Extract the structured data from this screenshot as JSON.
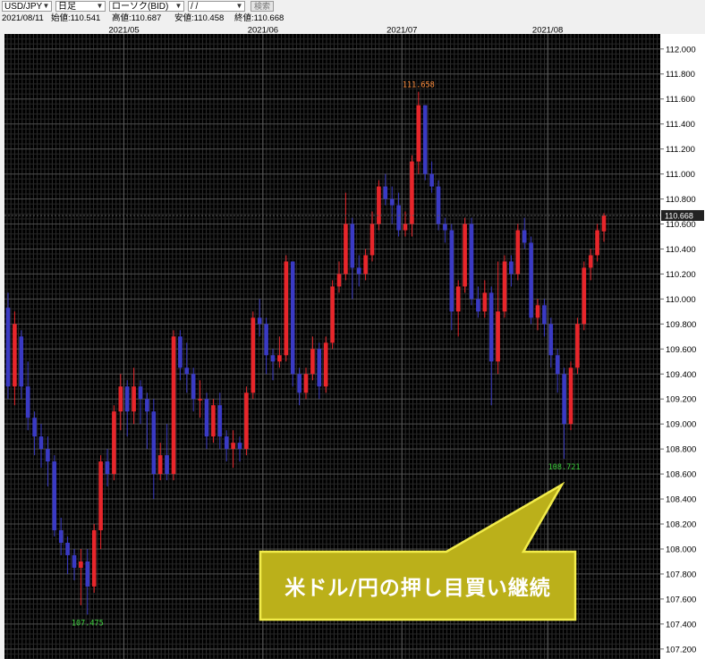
{
  "toolbar": {
    "symbol": "USD/JPY",
    "timeframe": "日足",
    "chart_style": "ローソク(BID)",
    "date": " /  / ",
    "search_label": "検索"
  },
  "ohlc": {
    "date": "2021/08/11",
    "open": "始値:110.541",
    "high": "高値:110.687",
    "low": "安値:110.458",
    "close": "終値:110.668"
  },
  "annotation": {
    "text": "米ドル/円の押し目買い継続"
  },
  "chart_data": {
    "type": "candlestick",
    "x_labels": [
      "2021/05",
      "2021/06",
      "2021/07",
      "2021/08"
    ],
    "y_ticks": [
      "112.000",
      "111.800",
      "111.600",
      "111.400",
      "111.200",
      "111.000",
      "110.800",
      "110.600",
      "110.400",
      "110.200",
      "110.000",
      "109.800",
      "109.600",
      "109.400",
      "109.200",
      "109.000",
      "108.800",
      "108.600",
      "108.400",
      "108.200",
      "108.000",
      "107.800",
      "107.600",
      "107.400",
      "107.200"
    ],
    "ylim": [
      107.12,
      112.12
    ],
    "grid": true,
    "last_price": "110.668",
    "high_label": "111.658",
    "low_labels": [
      "107.475",
      "108.721"
    ],
    "candles": [
      [
        109.93,
        109.3,
        110.05,
        109.2
      ],
      [
        109.3,
        109.8,
        109.9,
        109.15
      ],
      [
        109.7,
        109.3,
        109.75,
        109.2
      ],
      [
        109.3,
        109.05,
        109.5,
        108.95
      ],
      [
        109.05,
        108.9,
        109.1,
        108.75
      ],
      [
        108.9,
        108.8,
        109.0,
        108.65
      ],
      [
        108.8,
        108.7,
        108.9,
        108.5
      ],
      [
        108.7,
        108.15,
        108.75,
        108.1
      ],
      [
        108.15,
        108.05,
        108.25,
        107.95
      ],
      [
        108.05,
        107.95,
        108.1,
        107.8
      ],
      [
        107.95,
        107.85,
        108.0,
        107.75
      ],
      [
        107.85,
        107.9,
        108.0,
        107.55
      ],
      [
        107.9,
        107.7,
        108.0,
        107.475
      ],
      [
        107.7,
        108.15,
        108.2,
        107.65
      ],
      [
        108.15,
        108.7,
        108.75,
        108.0
      ],
      [
        108.7,
        108.6,
        108.8,
        108.5
      ],
      [
        108.6,
        109.1,
        109.15,
        108.55
      ],
      [
        109.1,
        109.3,
        109.4,
        108.95
      ],
      [
        109.3,
        109.1,
        109.35,
        108.9
      ],
      [
        109.1,
        109.3,
        109.45,
        109.0
      ],
      [
        109.3,
        109.2,
        109.35,
        109.0
      ],
      [
        109.2,
        109.1,
        109.25,
        108.8
      ],
      [
        109.1,
        108.6,
        109.2,
        108.4
      ],
      [
        108.6,
        108.75,
        108.85,
        108.55
      ],
      [
        108.75,
        108.6,
        109.0,
        108.55
      ],
      [
        108.6,
        109.7,
        109.75,
        108.55
      ],
      [
        109.7,
        109.45,
        109.75,
        109.35
      ],
      [
        109.45,
        109.4,
        109.65,
        109.25
      ],
      [
        109.4,
        109.2,
        109.45,
        109.1
      ],
      [
        109.2,
        109.2,
        109.35,
        109.05
      ],
      [
        109.2,
        108.9,
        109.25,
        108.8
      ],
      [
        108.9,
        109.15,
        109.2,
        108.85
      ],
      [
        109.15,
        108.9,
        109.25,
        108.8
      ],
      [
        108.9,
        108.8,
        108.95,
        108.7
      ],
      [
        108.8,
        108.85,
        108.95,
        108.65
      ],
      [
        108.85,
        108.8,
        108.9,
        108.7
      ],
      [
        108.8,
        109.25,
        109.3,
        108.75
      ],
      [
        109.25,
        109.85,
        109.9,
        109.2
      ],
      [
        109.85,
        109.8,
        110.0,
        109.7
      ],
      [
        109.8,
        109.55,
        109.85,
        109.4
      ],
      [
        109.55,
        109.5,
        109.6,
        109.35
      ],
      [
        109.5,
        109.55,
        109.7,
        109.45
      ],
      [
        109.55,
        110.3,
        110.35,
        109.5
      ],
      [
        110.3,
        109.4,
        110.3,
        109.3
      ],
      [
        109.4,
        109.25,
        109.45,
        109.15
      ],
      [
        109.25,
        109.4,
        109.45,
        109.2
      ],
      [
        109.4,
        109.6,
        109.7,
        109.35
      ],
      [
        109.6,
        109.3,
        109.65,
        109.2
      ],
      [
        109.3,
        109.65,
        109.7,
        109.25
      ],
      [
        109.65,
        110.1,
        110.15,
        109.6
      ],
      [
        110.1,
        110.2,
        110.3,
        110.05
      ],
      [
        110.2,
        110.6,
        110.85,
        110.15
      ],
      [
        110.6,
        110.25,
        110.65,
        110.0
      ],
      [
        110.25,
        110.2,
        110.35,
        110.1
      ],
      [
        110.2,
        110.35,
        110.4,
        110.15
      ],
      [
        110.35,
        110.6,
        110.7,
        110.3
      ],
      [
        110.6,
        110.9,
        110.95,
        110.55
      ],
      [
        110.9,
        110.8,
        111.0,
        110.75
      ],
      [
        110.8,
        110.75,
        110.9,
        110.6
      ],
      [
        110.75,
        110.55,
        110.85,
        110.5
      ],
      [
        110.55,
        110.6,
        110.7,
        110.5
      ],
      [
        110.6,
        111.1,
        111.15,
        110.5
      ],
      [
        111.1,
        111.55,
        111.658,
        111.0
      ],
      [
        111.55,
        111.0,
        111.55,
        110.95
      ],
      [
        111.0,
        110.9,
        111.1,
        110.85
      ],
      [
        110.9,
        110.6,
        110.95,
        110.55
      ],
      [
        110.6,
        110.55,
        110.65,
        110.45
      ],
      [
        110.55,
        109.9,
        110.6,
        109.75
      ],
      [
        109.9,
        110.1,
        110.15,
        109.7
      ],
      [
        110.1,
        110.6,
        110.65,
        110.05
      ],
      [
        110.6,
        110.0,
        110.65,
        109.95
      ],
      [
        110.0,
        109.9,
        110.1,
        109.85
      ],
      [
        109.9,
        110.05,
        110.15,
        109.85
      ],
      [
        110.05,
        109.5,
        110.1,
        109.15
      ],
      [
        109.5,
        109.9,
        110.3,
        109.4
      ],
      [
        109.9,
        110.3,
        110.35,
        109.85
      ],
      [
        110.3,
        110.2,
        110.35,
        110.1
      ],
      [
        110.2,
        110.55,
        110.6,
        110.15
      ],
      [
        110.55,
        110.45,
        110.65,
        110.4
      ],
      [
        110.45,
        109.85,
        110.5,
        109.8
      ],
      [
        109.85,
        109.95,
        110.0,
        109.75
      ],
      [
        109.95,
        109.8,
        110.0,
        109.7
      ],
      [
        109.8,
        109.55,
        109.85,
        109.45
      ],
      [
        109.55,
        109.4,
        109.6,
        109.25
      ],
      [
        109.4,
        109.0,
        109.45,
        108.721
      ],
      [
        109.0,
        109.45,
        109.5,
        108.95
      ],
      [
        109.45,
        109.8,
        109.85,
        109.4
      ],
      [
        109.8,
        110.25,
        110.3,
        109.75
      ],
      [
        110.25,
        110.35,
        110.4,
        110.15
      ],
      [
        110.35,
        110.55,
        110.6,
        110.3
      ],
      [
        110.541,
        110.668,
        110.687,
        110.458
      ]
    ]
  }
}
